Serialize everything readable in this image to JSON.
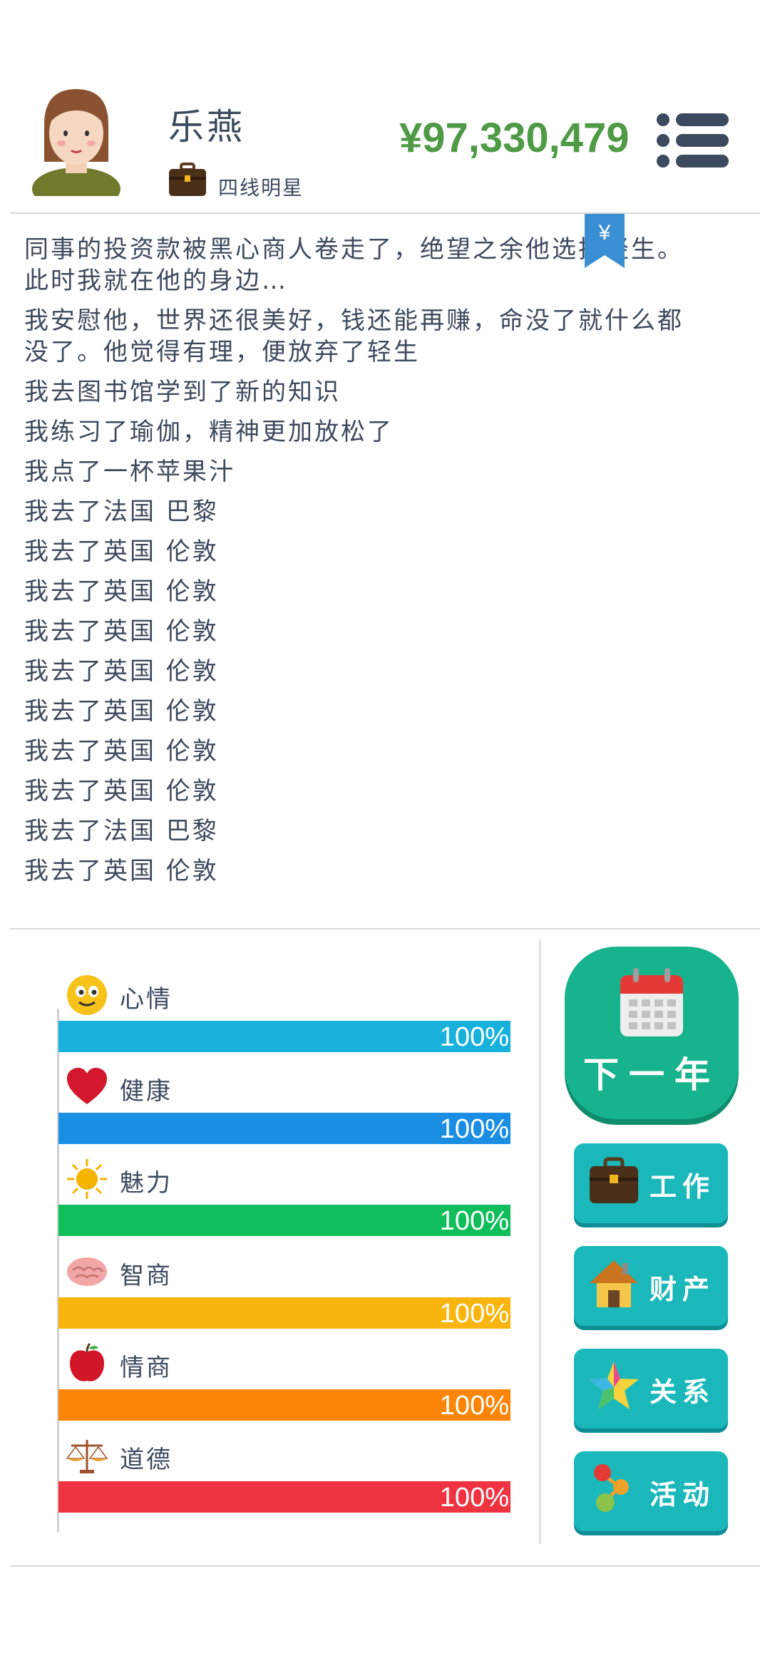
{
  "player": {
    "name": "乐燕",
    "rank": "四线明星",
    "money": "¥97,330,479"
  },
  "log": {
    "lines": [
      "同事的投资款被黑心商人卷走了，绝望之余他选择轻生。",
      "此时我就在他的身边…",
      "我安慰他，世界还很美好，钱还能再赚，命没了就什么都",
      "没了。他觉得有理，便放弃了轻生",
      "我去图书馆学到了新的知识",
      "我练习了瑜伽，精神更加放松了",
      "我点了一杯苹果汁",
      "我去了法国 巴黎",
      "我去了英国 伦敦",
      "我去了英国 伦敦",
      "我去了英国 伦敦",
      "我去了英国 伦敦",
      "我去了英国 伦敦",
      "我去了英国 伦敦",
      "我去了英国 伦敦",
      "我去了法国 巴黎",
      "我去了英国 伦敦"
    ]
  },
  "stats": [
    {
      "label": "心情",
      "value_text": "100%",
      "value": 1.0,
      "color": "#17b1dc",
      "icon": "smiley-icon"
    },
    {
      "label": "健康",
      "value_text": "100%",
      "value": 1.0,
      "color": "#1a8ee3",
      "icon": "heart-icon"
    },
    {
      "label": "魅力",
      "value_text": "100%",
      "value": 1.0,
      "color": "#0fbe5a",
      "icon": "sun-icon"
    },
    {
      "label": "智商",
      "value_text": "100%",
      "value": 1.0,
      "color": "#f9b50e",
      "icon": "brain-icon"
    },
    {
      "label": "情商",
      "value_text": "100%",
      "value": 1.0,
      "color": "#fa8506",
      "icon": "apple-icon"
    },
    {
      "label": "道德",
      "value_text": "100%",
      "value": 1.0,
      "color": "#ef3340",
      "icon": "scales-icon"
    }
  ],
  "actions": {
    "next_year": "下一年",
    "work": "工作",
    "assets": "财产",
    "relations": "关系",
    "activities": "活动"
  },
  "colors": {
    "money": "#4e9a45",
    "next_button": "#16b38c",
    "side_button": "#1ab8bb"
  }
}
